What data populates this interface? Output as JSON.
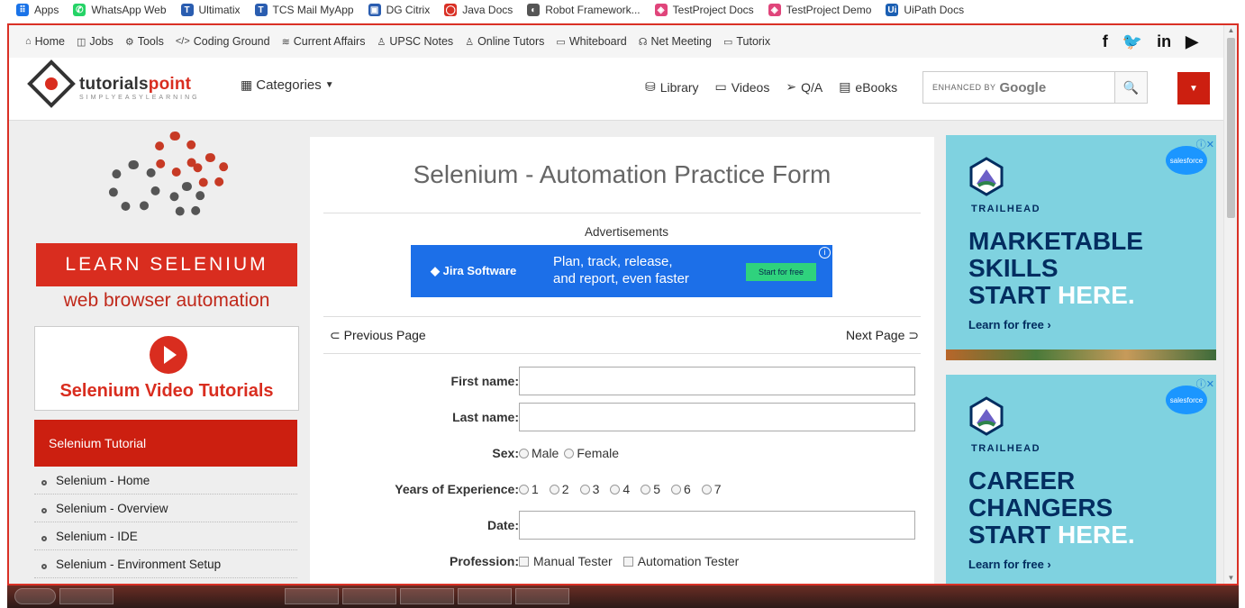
{
  "bookmarks": [
    {
      "label": "Apps",
      "icon": "apps-grid-icon",
      "color": "#1a73e8"
    },
    {
      "label": "WhatsApp Web",
      "icon": "whatsapp-icon",
      "color": "#25d366"
    },
    {
      "label": "Ultimatix",
      "icon": "tata-icon",
      "color": "#2a5db0"
    },
    {
      "label": "TCS Mail MyApp",
      "icon": "tata-icon",
      "color": "#2a5db0"
    },
    {
      "label": "DG Citrix",
      "icon": "citrix-icon",
      "color": "#2a5db0"
    },
    {
      "label": "Java Docs",
      "icon": "oracle-icon",
      "color": "#d93025"
    },
    {
      "label": "Robot Framework...",
      "icon": "globe-icon",
      "color": "#555555"
    },
    {
      "label": "TestProject Docs",
      "icon": "testproject-icon",
      "color": "#e0457b"
    },
    {
      "label": "TestProject Demo",
      "icon": "testproject-icon",
      "color": "#e0457b"
    },
    {
      "label": "UiPath Docs",
      "icon": "uipath-icon",
      "color": "#1b5fb3"
    }
  ],
  "topnav": [
    {
      "label": "Home",
      "icon": "home-icon"
    },
    {
      "label": "Jobs",
      "icon": "briefcase-icon"
    },
    {
      "label": "Tools",
      "icon": "tools-icon"
    },
    {
      "label": "Coding Ground",
      "icon": "code-icon"
    },
    {
      "label": "Current Affairs",
      "icon": "affairs-icon"
    },
    {
      "label": "UPSC Notes",
      "icon": "notes-icon"
    },
    {
      "label": "Online Tutors",
      "icon": "user-icon"
    },
    {
      "label": "Whiteboard",
      "icon": "whiteboard-icon"
    },
    {
      "label": "Net Meeting",
      "icon": "meeting-icon"
    },
    {
      "label": "Tutorix",
      "icon": "tutorix-icon"
    }
  ],
  "social": {
    "facebook": "f",
    "twitter": "🐦",
    "linkedin": "in",
    "youtube": "▶"
  },
  "header": {
    "logo_main": "tutorials",
    "logo_accent": "point",
    "logo_sub": "SIMPLYEASYLEARNING",
    "categories": "Categories",
    "nav": [
      {
        "label": "Library",
        "icon": "library-icon"
      },
      {
        "label": "Videos",
        "icon": "video-icon"
      },
      {
        "label": "Q/A",
        "icon": "send-icon"
      },
      {
        "label": "eBooks",
        "icon": "ebook-icon"
      }
    ],
    "search_enhanced": "ENHANCED BY",
    "search_google": "Google"
  },
  "sidebar": {
    "learn": "LEARN SELENIUM",
    "subtitle": "web browser automation",
    "video_title": "Selenium Video Tutorials",
    "tutorial_head": "Selenium Tutorial",
    "items": [
      "Selenium - Home",
      "Selenium - Overview",
      "Selenium - IDE",
      "Selenium - Environment Setup"
    ]
  },
  "main": {
    "title": "Selenium - Automation Practice Form",
    "ads_label": "Advertisements",
    "jira_brand": "◆ Jira Software",
    "jira_line1": "Plan, track, release,",
    "jira_line2": "and report, even faster",
    "jira_button": "Start for free",
    "prev": "Previous Page",
    "next": "Next Page",
    "form": {
      "first_name": "First name:",
      "last_name": "Last name:",
      "sex": "Sex:",
      "sex_options": [
        "Male",
        "Female"
      ],
      "experience": "Years of Experience:",
      "experience_options": [
        "1",
        "2",
        "3",
        "4",
        "5",
        "6",
        "7"
      ],
      "date": "Date:",
      "profession": "Profession:",
      "profession_options": [
        "Manual Tester",
        "Automation Tester"
      ]
    }
  },
  "ads": [
    {
      "brand": "TRAILHEAD",
      "line1": "MARKETABLE",
      "line2": "SKILLS",
      "line3a": "START ",
      "line3b": "HERE.",
      "cta": "Learn for free ›",
      "sf": "salesforce"
    },
    {
      "brand": "TRAILHEAD",
      "line1": "CAREER",
      "line2": "CHANGERS",
      "line3a": "START ",
      "line3b": "HERE.",
      "cta": "Learn for free ›",
      "sf": "salesforce"
    }
  ]
}
